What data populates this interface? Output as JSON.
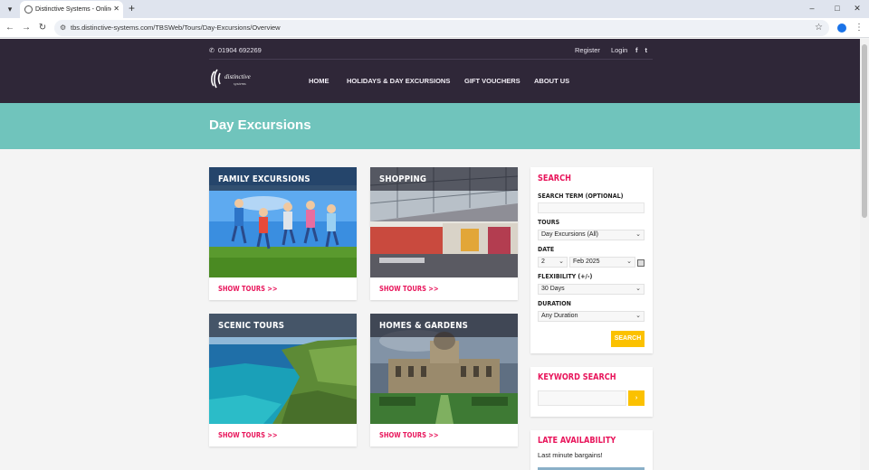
{
  "browser": {
    "tab_title": "Distinctive Systems - Online bo",
    "url": "tbs.distinctive-systems.com/TBSWeb/Tours/Day-Excursions/Overview"
  },
  "header": {
    "phone": "01904 692269",
    "register": "Register",
    "login": "Login",
    "logo_text": "distinctive",
    "logo_sub": "systems",
    "nav": [
      "HOME",
      "HOLIDAYS & DAY EXCURSIONS",
      "GIFT VOUCHERS",
      "ABOUT US"
    ]
  },
  "page": {
    "title": "Day Excursions"
  },
  "cards": [
    {
      "title": "FAMILY EXCURSIONS",
      "link": "SHOW TOURS >>"
    },
    {
      "title": "SHOPPING",
      "link": "SHOW TOURS >>"
    },
    {
      "title": "SCENIC TOURS",
      "link": "SHOW TOURS >>"
    },
    {
      "title": "HOMES & GARDENS",
      "link": "SHOW TOURS >>"
    }
  ],
  "search": {
    "title": "SEARCH",
    "term_label": "SEARCH TERM (OPTIONAL)",
    "term_value": "",
    "tours_label": "TOURS",
    "tours_value": "Day Excursions (All)",
    "date_label": "DATE",
    "date_day": "2",
    "date_month": "Feb 2025",
    "flex_label": "FLEXIBILITY (+/-)",
    "flex_value": "30 Days",
    "duration_label": "DURATION",
    "duration_value": "Any Duration",
    "button": "SEARCH"
  },
  "keyword": {
    "title": "KEYWORD SEARCH",
    "value": "",
    "button": "›"
  },
  "late": {
    "title": "LATE AVAILABILITY",
    "text": "Last minute bargains!"
  },
  "colors": {
    "header_bg": "#2f2738",
    "band_bg": "#70c4bc",
    "accent": "#e8155b",
    "button": "#fbc100"
  }
}
